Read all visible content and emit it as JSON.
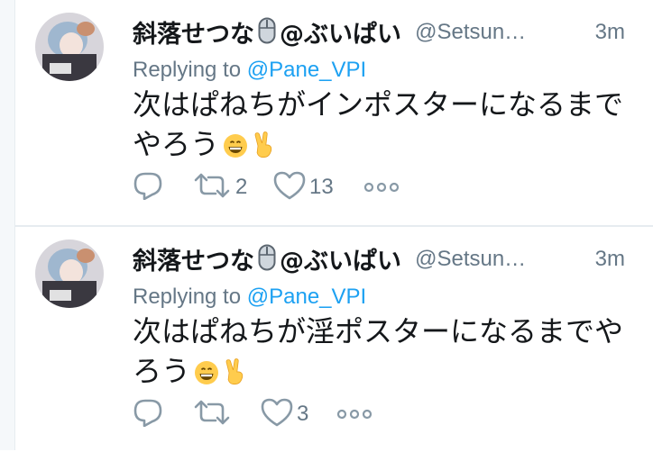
{
  "tweets": [
    {
      "display_name_before": "斜落せつな",
      "display_name_after": "@ぶいぱい",
      "handle": "@Setsun…",
      "time": "3m",
      "replying_label": "Replying to",
      "replying_to": "@Pane_VPI",
      "text_line1": "次はぱねちがインポスターになるまで",
      "text_line2": "やろう",
      "reply_icon": "reply-icon",
      "retweet_count": "2",
      "like_count": "13"
    },
    {
      "display_name_before": "斜落せつな",
      "display_name_after": "@ぶいぱい",
      "handle": "@Setsun…",
      "time": "3m",
      "replying_label": "Replying to",
      "replying_to": "@Pane_VPI",
      "text_line1": "次はぱねちが淫ポスターになるまでや",
      "text_line2": "ろう",
      "reply_icon": "reply-icon",
      "retweet_count": "",
      "like_count": "3"
    }
  ],
  "colors": {
    "secondary": "#657786",
    "link": "#1da1f2",
    "divider": "#e6ecf0"
  }
}
